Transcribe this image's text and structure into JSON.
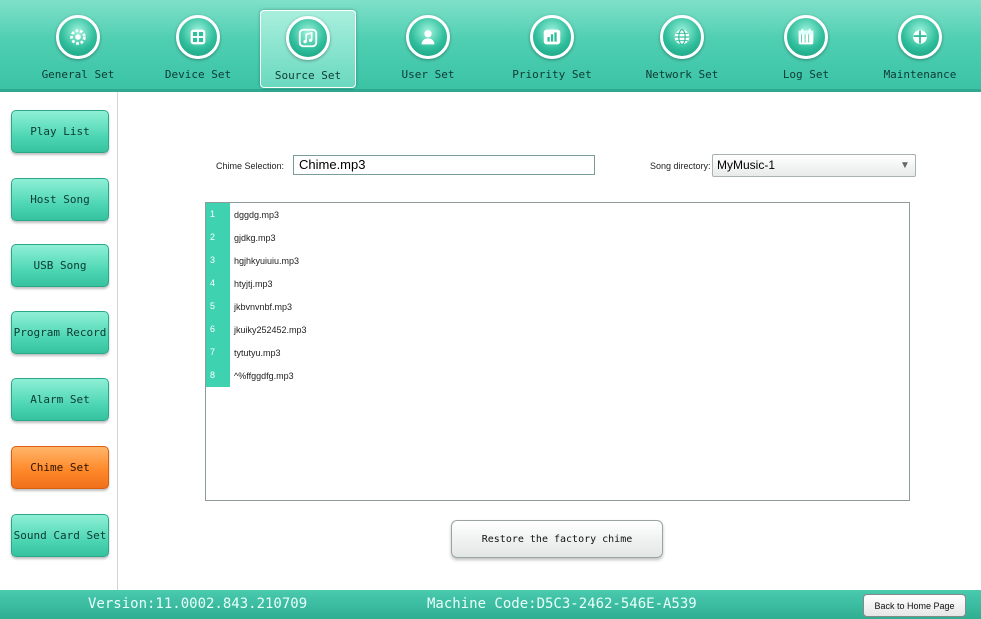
{
  "nav": {
    "items": [
      {
        "label": "General Set",
        "icon": "gear-icon"
      },
      {
        "label": "Device Set",
        "icon": "device-grid-icon"
      },
      {
        "label": "Source Set",
        "icon": "music-note-icon"
      },
      {
        "label": "User Set",
        "icon": "user-icon"
      },
      {
        "label": "Priority Set",
        "icon": "bar-chart-icon"
      },
      {
        "label": "Network Set",
        "icon": "globe-icon"
      },
      {
        "label": "Log Set",
        "icon": "calendar-icon"
      },
      {
        "label": "Maintenance",
        "icon": "shield-icon"
      }
    ],
    "active": "Source Set"
  },
  "sidebar": {
    "items": [
      {
        "label": "Play List"
      },
      {
        "label": "Host Song"
      },
      {
        "label": "USB Song"
      },
      {
        "label": "Program Record"
      },
      {
        "label": "Alarm Set"
      },
      {
        "label": "Chime Set"
      },
      {
        "label": "Sound Card Set"
      }
    ],
    "active": "Chime Set"
  },
  "chime": {
    "label": "Chime Selection:",
    "value": "Chime.mp3"
  },
  "directory": {
    "label": "Song directory:",
    "value": "MyMusic-1"
  },
  "songs": [
    {
      "num": "1",
      "name": "dggdg.mp3"
    },
    {
      "num": "2",
      "name": "gjdkg.mp3"
    },
    {
      "num": "3",
      "name": "hgjhkyuiuiu.mp3"
    },
    {
      "num": "4",
      "name": "htyjtj.mp3"
    },
    {
      "num": "5",
      "name": "jkbvnvnbf.mp3"
    },
    {
      "num": "6",
      "name": "jkuiky252452.mp3"
    },
    {
      "num": "7",
      "name": "tytutyu.mp3"
    },
    {
      "num": "8",
      "name": "^%ffggdfg.mp3"
    }
  ],
  "restore_label": "Restore the factory chime",
  "footer": {
    "version": "Version:11.0002.843.210709",
    "machine_code": "Machine Code:D5C3-2462-546E-A539",
    "home_label": "Back to Home Page"
  },
  "colors": {
    "accent": "#3fd2b0",
    "active_orange": "#ff8a2b",
    "footer": "#2fae92"
  }
}
